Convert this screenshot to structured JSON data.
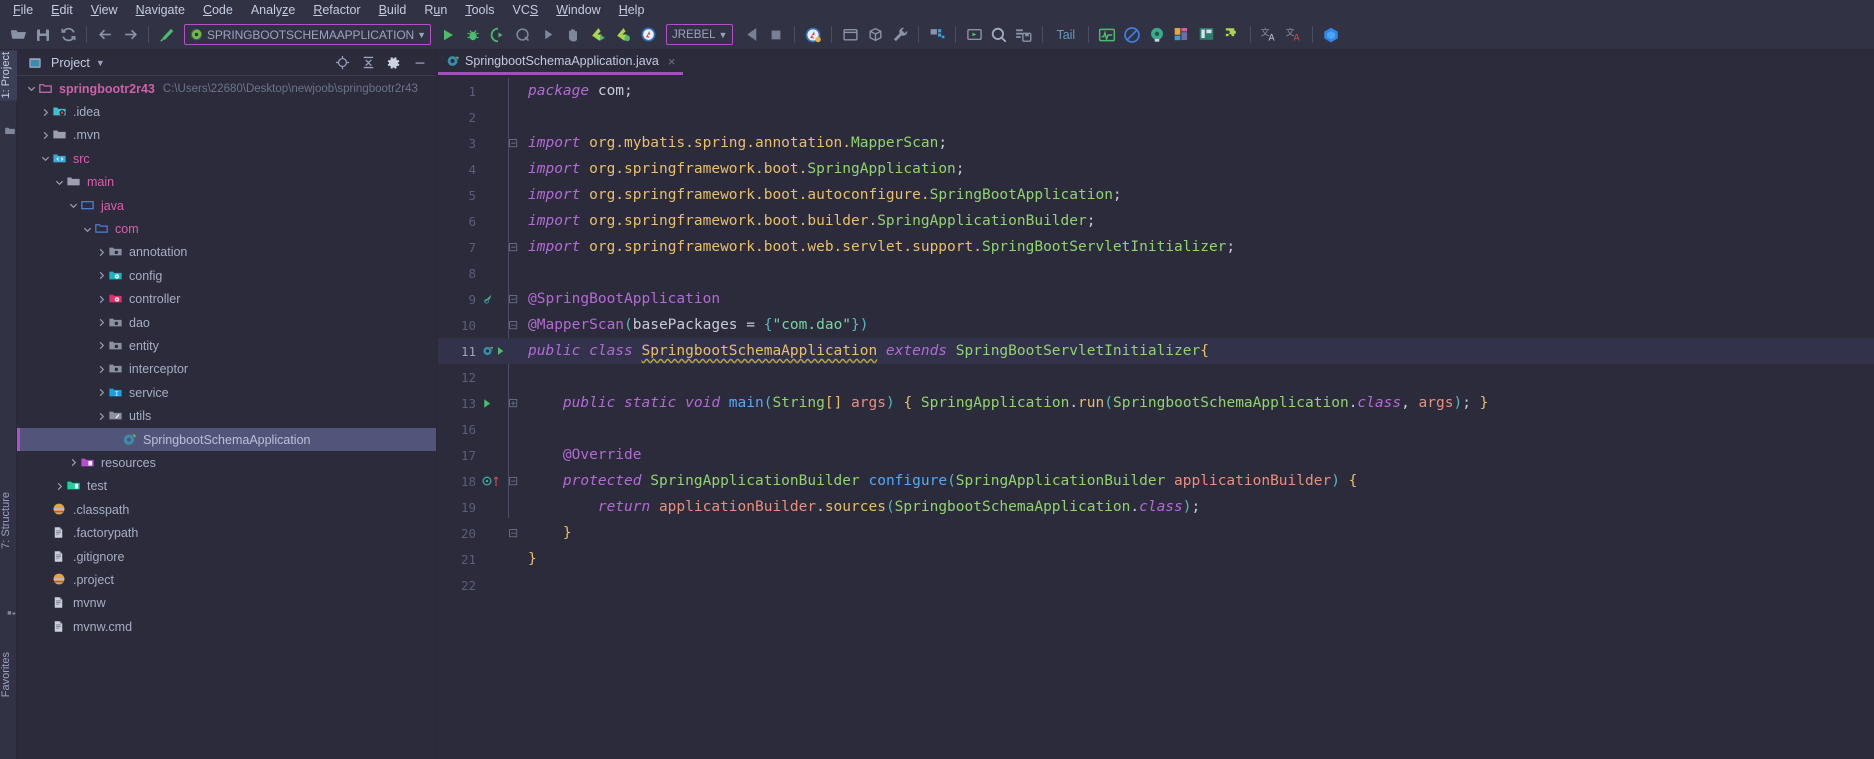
{
  "menubar": {
    "items": [
      {
        "label": "File",
        "mnemonic": "F"
      },
      {
        "label": "Edit",
        "mnemonic": "E"
      },
      {
        "label": "View",
        "mnemonic": "V"
      },
      {
        "label": "Navigate",
        "mnemonic": "N"
      },
      {
        "label": "Code",
        "mnemonic": "C"
      },
      {
        "label": "Analyze",
        "mnemonic": "z"
      },
      {
        "label": "Refactor",
        "mnemonic": "R"
      },
      {
        "label": "Build",
        "mnemonic": "B"
      },
      {
        "label": "Run",
        "mnemonic": "u"
      },
      {
        "label": "Tools",
        "mnemonic": "T"
      },
      {
        "label": "VCS",
        "mnemonic": "S"
      },
      {
        "label": "Window",
        "mnemonic": "W"
      },
      {
        "label": "Help",
        "mnemonic": "H"
      }
    ]
  },
  "toolbar": {
    "icons": [
      "open-folder-icon",
      "save-all-icon",
      "sync-refresh-icon",
      "back-arrow-icon",
      "forward-arrow-icon",
      "build-hammer-icon"
    ],
    "run_config": {
      "name": "SPRINGBOOTSCHEMAAPPLICATION",
      "icon": "spring-boot-icon",
      "dropdown": "chevron-down-icon"
    },
    "run_icons": [
      "run-icon",
      "debug-icon",
      "run-with-coverage-icon",
      "profile-icon",
      "rerun-icon",
      "attach-debugger-icon",
      "jrebel-run-icon",
      "jrebel-debug-icon",
      "jrebel-circle-icon"
    ],
    "jrebel": {
      "label": "JREBEL",
      "dropdown": "chevron-down-icon"
    },
    "post_icons": [
      "update-app-icon",
      "stop-icon",
      "jrebel-globe-icon",
      "sep",
      "terminal-window-icon",
      "package-download-icon",
      "wrench-settings-icon",
      "sep",
      "project-structure-icon",
      "sep",
      "run-window-icon",
      "search-everywhere-icon",
      "database-save-icon"
    ],
    "tail_label": "Tail",
    "tail_icons": [
      "monitor-graph-icon",
      "no-entry-icon",
      "recorder-dot-icon",
      "layout-blocks-icon",
      "layout-panel-icon",
      "plugin-puzzle-icon",
      "translate-a-icon",
      "translate-a-red-icon",
      "baidu-icon"
    ]
  },
  "left_strips": [
    {
      "label": "1: Project",
      "mnemonic": "1",
      "selected": true
    },
    {
      "label": "7: Structure",
      "mnemonic": "7",
      "selected": false
    },
    {
      "label": "Favorites",
      "mnemonic": "",
      "selected": false
    }
  ],
  "project_panel": {
    "title": "Project",
    "dropdown_icon": "chevron-down-icon",
    "header_icons": [
      "locate-target-icon",
      "collapse-all-icon",
      "settings-gear-icon",
      "hide-minimize-icon"
    ],
    "tree": [
      {
        "depth": 0,
        "label": "springbootr2r43",
        "path": "C:\\Users\\22680\\Desktop\\newjoob\\springbootr2r43",
        "icon": "project-folder-icon",
        "state": "expanded",
        "style": "root",
        "selected": false
      },
      {
        "depth": 1,
        "label": ".idea",
        "path": "",
        "icon": "idea-folder-icon",
        "state": "collapsed",
        "style": "plain",
        "selected": false
      },
      {
        "depth": 1,
        "label": ".mvn",
        "path": "",
        "icon": "folder-icon",
        "state": "collapsed",
        "style": "plain",
        "selected": false
      },
      {
        "depth": 1,
        "label": "src",
        "path": "",
        "icon": "source-folder-icon",
        "state": "expanded",
        "style": "mod",
        "selected": false
      },
      {
        "depth": 2,
        "label": "main",
        "path": "",
        "icon": "folder-icon",
        "state": "expanded",
        "style": "mod",
        "selected": false
      },
      {
        "depth": 3,
        "label": "java",
        "path": "",
        "icon": "source-root-icon",
        "state": "expanded",
        "style": "mod",
        "selected": false
      },
      {
        "depth": 4,
        "label": "com",
        "path": "",
        "icon": "package-icon",
        "state": "expanded",
        "style": "mod",
        "selected": false
      },
      {
        "depth": 5,
        "label": "annotation",
        "path": "",
        "icon": "package-grey-icon",
        "state": "collapsed",
        "style": "plain",
        "selected": false
      },
      {
        "depth": 5,
        "label": "config",
        "path": "",
        "icon": "package-config-icon",
        "state": "collapsed",
        "style": "plain",
        "selected": false
      },
      {
        "depth": 5,
        "label": "controller",
        "path": "",
        "icon": "package-controller-icon",
        "state": "collapsed",
        "style": "plain",
        "selected": false
      },
      {
        "depth": 5,
        "label": "dao",
        "path": "",
        "icon": "package-grey-icon",
        "state": "collapsed",
        "style": "plain",
        "selected": false
      },
      {
        "depth": 5,
        "label": "entity",
        "path": "",
        "icon": "package-grey-icon",
        "state": "collapsed",
        "style": "plain",
        "selected": false
      },
      {
        "depth": 5,
        "label": "interceptor",
        "path": "",
        "icon": "package-grey-icon",
        "state": "collapsed",
        "style": "plain",
        "selected": false
      },
      {
        "depth": 5,
        "label": "service",
        "path": "",
        "icon": "package-service-icon",
        "state": "collapsed",
        "style": "plain",
        "selected": false
      },
      {
        "depth": 5,
        "label": "utils",
        "path": "",
        "icon": "package-utils-icon",
        "state": "collapsed",
        "style": "plain",
        "selected": false
      },
      {
        "depth": 6,
        "label": "SpringbootSchemaApplication",
        "path": "",
        "icon": "spring-boot-class-icon",
        "state": "leaf",
        "style": "plain",
        "selected": true
      },
      {
        "depth": 3,
        "label": "resources",
        "path": "",
        "icon": "resources-folder-icon",
        "state": "collapsed",
        "style": "plain",
        "selected": false
      },
      {
        "depth": 2,
        "label": "test",
        "path": "",
        "icon": "test-folder-icon",
        "state": "collapsed",
        "style": "plain",
        "selected": false
      },
      {
        "depth": 1,
        "label": ".classpath",
        "path": "",
        "icon": "eclipse-file-icon",
        "state": "leaf",
        "style": "plain",
        "selected": false
      },
      {
        "depth": 1,
        "label": ".factorypath",
        "path": "",
        "icon": "text-file-icon",
        "state": "leaf",
        "style": "plain",
        "selected": false
      },
      {
        "depth": 1,
        "label": ".gitignore",
        "path": "",
        "icon": "text-file-icon",
        "state": "leaf",
        "style": "plain",
        "selected": false
      },
      {
        "depth": 1,
        "label": ".project",
        "path": "",
        "icon": "eclipse-file-icon",
        "state": "leaf",
        "style": "plain",
        "selected": false
      },
      {
        "depth": 1,
        "label": "mvnw",
        "path": "",
        "icon": "text-file-icon",
        "state": "leaf",
        "style": "plain",
        "selected": false
      },
      {
        "depth": 1,
        "label": "mvnw.cmd",
        "path": "",
        "icon": "text-file-icon",
        "state": "leaf",
        "style": "plain",
        "selected": false
      }
    ]
  },
  "editor": {
    "tab": {
      "label": "SpringbootSchemaApplication.java",
      "icon": "spring-boot-class-icon",
      "close": "×",
      "active": true
    },
    "breadcrumb_ghost": "springbootr2r43",
    "current_line": 11,
    "lines": [
      {
        "n": "1",
        "gutter": "",
        "fold": "",
        "tokens": [
          [
            "kw2",
            "package"
          ],
          [
            "id",
            " com"
          ],
          [
            "punc",
            ";"
          ]
        ]
      },
      {
        "n": "2",
        "gutter": "",
        "fold": "",
        "tokens": []
      },
      {
        "n": "3",
        "gutter": "",
        "fold": "-",
        "tokens": [
          [
            "kw2",
            "import"
          ],
          [
            "pkg",
            " org.mybatis.spring.annotation."
          ],
          [
            "cls",
            "MapperScan"
          ],
          [
            "punc",
            ";"
          ]
        ]
      },
      {
        "n": "4",
        "gutter": "",
        "fold": "",
        "tokens": [
          [
            "kw2",
            "import"
          ],
          [
            "pkg",
            " org.springframework.boot."
          ],
          [
            "cls",
            "SpringApplication"
          ],
          [
            "punc",
            ";"
          ]
        ]
      },
      {
        "n": "5",
        "gutter": "",
        "fold": "",
        "tokens": [
          [
            "kw2",
            "import"
          ],
          [
            "pkg",
            " org.springframework.boot.autoconfigure."
          ],
          [
            "cls",
            "SpringBootApplication"
          ],
          [
            "punc",
            ";"
          ]
        ]
      },
      {
        "n": "6",
        "gutter": "",
        "fold": "",
        "tokens": [
          [
            "kw2",
            "import"
          ],
          [
            "pkg",
            " org.springframework.boot.builder."
          ],
          [
            "cls",
            "SpringApplicationBuilder"
          ],
          [
            "punc",
            ";"
          ]
        ]
      },
      {
        "n": "7",
        "gutter": "",
        "fold": "-",
        "tokens": [
          [
            "kw2",
            "import"
          ],
          [
            "pkg",
            " org.springframework.boot.web.servlet.support."
          ],
          [
            "cls",
            "SpringBootServletInitializer"
          ],
          [
            "punc",
            ";"
          ]
        ]
      },
      {
        "n": "8",
        "gutter": "",
        "fold": "",
        "tokens": []
      },
      {
        "n": "9",
        "gutter": "bean-icon",
        "fold": "-",
        "tokens": [
          [
            "ann",
            "@SpringBootApplication"
          ]
        ]
      },
      {
        "n": "10",
        "gutter": "",
        "fold": "-",
        "tokens": [
          [
            "ann",
            "@MapperScan"
          ],
          [
            "brace2",
            "("
          ],
          [
            "id",
            "basePackages"
          ],
          [
            "punc",
            " = "
          ],
          [
            "brace2",
            "{"
          ],
          [
            "str",
            "\"com.dao\""
          ],
          [
            "brace2",
            "}"
          ],
          [
            "brace2",
            ")"
          ]
        ]
      },
      {
        "n": "11",
        "gutter": "spring-run-icon",
        "fold": "",
        "current": true,
        "tokens": [
          [
            "kw2",
            "public class "
          ],
          [
            "clsname",
            "SpringbootSchemaApplication"
          ],
          [
            "kw2",
            " extends "
          ],
          [
            "cls",
            "SpringBootServletInitializer"
          ],
          [
            "brace1",
            "{"
          ]
        ]
      },
      {
        "n": "12",
        "gutter": "",
        "fold": "",
        "tokens": []
      },
      {
        "n": "13",
        "gutter": "run-green-icon",
        "fold": "+",
        "tokens": [
          [
            "sp",
            "    "
          ],
          [
            "kw2",
            "public static void "
          ],
          [
            "meth",
            "main"
          ],
          [
            "brace2",
            "("
          ],
          [
            "cls",
            "String"
          ],
          [
            "brace1",
            "[]"
          ],
          [
            "par",
            " args"
          ],
          [
            "brace2",
            ")"
          ],
          [
            "punc",
            " "
          ],
          [
            "brace1",
            "{"
          ],
          [
            "punc",
            " "
          ],
          [
            "cls",
            "SpringApplication"
          ],
          [
            "punc",
            "."
          ],
          [
            "methi",
            "run"
          ],
          [
            "brace2",
            "("
          ],
          [
            "cls",
            "SpringbootSchemaApplication"
          ],
          [
            "punc",
            "."
          ],
          [
            "kw2",
            "class"
          ],
          [
            "punc",
            ", "
          ],
          [
            "par",
            "args"
          ],
          [
            "brace2",
            ")"
          ],
          [
            "punc",
            ";"
          ],
          [
            "punc",
            " "
          ],
          [
            "brace1",
            "}"
          ]
        ]
      },
      {
        "n": "16",
        "gutter": "",
        "fold": "",
        "tokens": []
      },
      {
        "n": "17",
        "gutter": "",
        "fold": "",
        "tokens": [
          [
            "sp",
            "    "
          ],
          [
            "ann",
            "@Override"
          ]
        ]
      },
      {
        "n": "18",
        "gutter": "override-icon",
        "fold": "-",
        "tokens": [
          [
            "sp",
            "    "
          ],
          [
            "kw2",
            "protected "
          ],
          [
            "cls",
            "SpringApplicationBuilder"
          ],
          [
            "punc",
            " "
          ],
          [
            "meth",
            "configure"
          ],
          [
            "brace2",
            "("
          ],
          [
            "cls",
            "SpringApplicationBuilder"
          ],
          [
            "par",
            " applicationBuilder"
          ],
          [
            "brace2",
            ")"
          ],
          [
            "punc",
            " "
          ],
          [
            "brace1",
            "{"
          ]
        ]
      },
      {
        "n": "19",
        "gutter": "",
        "fold": "",
        "tokens": [
          [
            "sp",
            "        "
          ],
          [
            "kw2",
            "return "
          ],
          [
            "par",
            "applicationBuilder"
          ],
          [
            "punc",
            "."
          ],
          [
            "methi",
            "sources"
          ],
          [
            "brace2",
            "("
          ],
          [
            "cls",
            "SpringbootSchemaApplication"
          ],
          [
            "punc",
            "."
          ],
          [
            "kw2",
            "class"
          ],
          [
            "brace2",
            ")"
          ],
          [
            "punc",
            ";"
          ]
        ]
      },
      {
        "n": "20",
        "gutter": "",
        "fold": "-",
        "tokens": [
          [
            "sp",
            "    "
          ],
          [
            "brace1",
            "}"
          ]
        ]
      },
      {
        "n": "21",
        "gutter": "",
        "fold": "",
        "tokens": [
          [
            "brace1",
            "}"
          ]
        ]
      },
      {
        "n": "22",
        "gutter": "",
        "fold": "",
        "tokens": []
      }
    ]
  },
  "colors": {
    "bg": "#2b2b3b",
    "panel_bg": "#313345",
    "accent_purple": "#b150c8",
    "selection": "#52557a",
    "current_line": "#32334a",
    "keyword": "#b36ad4",
    "string": "#77d7a0",
    "class": "#91d370",
    "method": "#56a8f5",
    "field": "#e8bf6a"
  }
}
